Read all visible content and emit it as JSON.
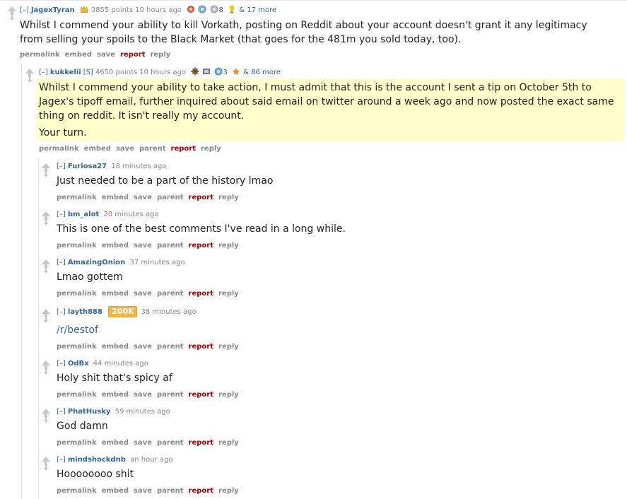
{
  "comments": [
    {
      "toggle": "[–]",
      "author": "JagexTyran",
      "points": "3855 points",
      "time": "10 hours ago",
      "award_count_1": "8",
      "more_awards": "& 17 more",
      "text": [
        "Whilst I commend your ability to kill Vorkath, posting on Reddit about your account doesn't grant it any legitimacy from selling your spoils to the Black Market (that goes for the 481m you sold today, too)."
      ],
      "buttons": [
        "permalink",
        "embed",
        "save",
        "report",
        "reply"
      ]
    },
    {
      "toggle": "[–]",
      "author": "kukkelii",
      "flair": "[S]",
      "points": "4650 points",
      "time": "10 hours ago",
      "award_count_1": "3",
      "more_awards": "& 86 more",
      "text": [
        "Whilst I commend your ability to take action, I must admit that this is the account I sent a tip on October 5th to Jagex's tipoff email, further inquired about said email on twitter around a week ago and now posted the exact same thing on reddit. It isn't really my account.",
        "Your turn."
      ],
      "buttons": [
        "permalink",
        "embed",
        "save",
        "parent",
        "report",
        "reply"
      ]
    },
    {
      "toggle": "[–]",
      "author": "Furiosa27",
      "time": "18 minutes ago",
      "text": [
        "Just needed to be a part of the history lmao"
      ],
      "buttons": [
        "permalink",
        "embed",
        "save",
        "parent",
        "report",
        "reply"
      ]
    },
    {
      "toggle": "[–]",
      "author": "bm_alot",
      "time": "20 minutes ago",
      "text": [
        "This is one of the best comments I've read in a long while."
      ],
      "buttons": [
        "permalink",
        "embed",
        "save",
        "parent",
        "report",
        "reply"
      ]
    },
    {
      "toggle": "[–]",
      "author": "AmazingOnion",
      "time": "37 minutes ago",
      "text": [
        "Lmao gottem"
      ],
      "buttons": [
        "permalink",
        "embed",
        "save",
        "parent",
        "report",
        "reply"
      ]
    },
    {
      "toggle": "[–]",
      "author": "layth888",
      "badge": "200K",
      "time": "38 minutes ago",
      "text": [
        "/r/bestof"
      ],
      "buttons": [
        "permalink",
        "embed",
        "save",
        "parent",
        "report",
        "reply"
      ]
    },
    {
      "toggle": "[–]",
      "author": "OdBx",
      "time": "44 minutes ago",
      "text": [
        "Holy shit that's spicy af"
      ],
      "buttons": [
        "permalink",
        "embed",
        "save",
        "parent",
        "report",
        "reply"
      ]
    },
    {
      "toggle": "[–]",
      "author": "PhatHusky",
      "time": "59 minutes ago",
      "text": [
        "God damn"
      ],
      "buttons": [
        "permalink",
        "embed",
        "save",
        "parent",
        "report",
        "reply"
      ]
    },
    {
      "toggle": "[–]",
      "author": "mindshockdnb",
      "time": "an hour ago",
      "text": [
        "Hoooooooo shit"
      ],
      "buttons": [
        "permalink",
        "embed",
        "save",
        "parent",
        "report",
        "reply"
      ]
    }
  ],
  "colors": {
    "link": "#336699",
    "report": "#aa0000",
    "meta": "#888888",
    "highlight": "#ffffcc",
    "badge": "#f2b548"
  },
  "icons": [
    "upvote-arrow-icon",
    "downvote-arrow-icon",
    "crown-award-icon",
    "award-icon",
    "trophy-award-icon"
  ]
}
